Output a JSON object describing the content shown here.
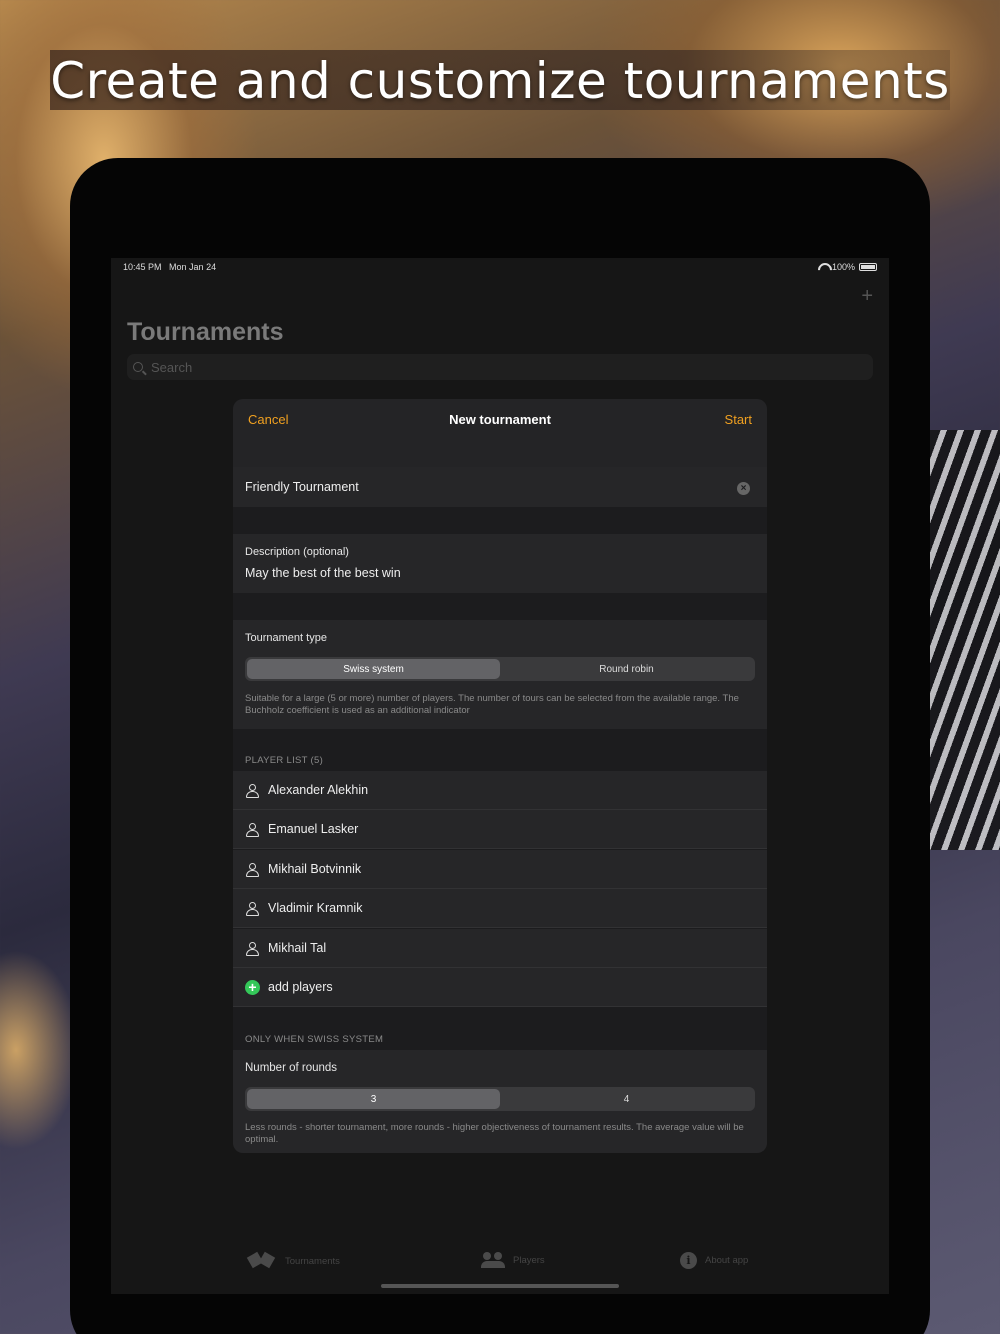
{
  "headline": "Create and customize tournaments",
  "status_bar": {
    "time": "10:45 PM",
    "date": "Mon Jan 24",
    "battery": "100%"
  },
  "page": {
    "title": "Tournaments",
    "search_placeholder": "Search",
    "add_icon": "plus-icon"
  },
  "modal": {
    "cancel": "Cancel",
    "title": "New tournament",
    "start": "Start",
    "name_value": "Friendly Tournament",
    "description_label": "Description (optional)",
    "description_value": "May the best of the best win",
    "type_label": "Tournament type",
    "type_options": [
      "Swiss system",
      "Round robin"
    ],
    "type_selected": "Swiss system",
    "type_note": "Suitable for a large (5 or more) number of players. The number of tours can be selected from the available range. The Buchholz coefficient is used as an additional indicator",
    "player_list_header": "PLAYER LIST (5)",
    "players": [
      "Alexander Alekhin",
      "Emanuel Lasker",
      "Mikhail Botvinnik",
      "Vladimir Kramnik",
      "Mikhail Tal"
    ],
    "add_players": "add players",
    "swiss_header": "ONLY WHEN SWISS SYSTEM",
    "rounds_label": "Number of rounds",
    "rounds_options": [
      "3",
      "4"
    ],
    "rounds_selected": "3",
    "rounds_note": "Less rounds - shorter tournament, more rounds - higher objectiveness of tournament results. The average value will be optimal."
  },
  "tab_bar": {
    "tabs": [
      {
        "label": "Tournaments",
        "icon": "flags-icon"
      },
      {
        "label": "Players",
        "icon": "people-icon"
      },
      {
        "label": "About app",
        "icon": "info-icon"
      }
    ]
  },
  "colors": {
    "accent": "#f0a020",
    "add_green": "#34c759",
    "background": "#161616"
  }
}
